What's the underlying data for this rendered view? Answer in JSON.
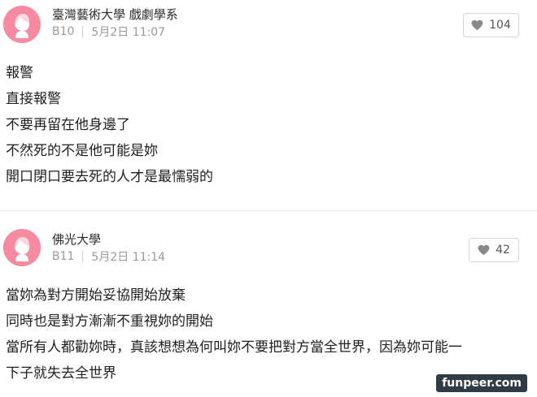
{
  "comments": [
    {
      "author": "臺灣藝術大學 戲劇學系",
      "floor": "B10",
      "time": "5月2日 11:07",
      "likes": "104",
      "lines": [
        "報警",
        "直接報警",
        "不要再留在他身邊了",
        "不然死的不是他可能是妳",
        "開口閉口要去死的人才是最懦弱的"
      ]
    },
    {
      "author": "佛光大學",
      "floor": "B11",
      "time": "5月2日 11:14",
      "likes": "42",
      "lines": [
        "當妳為對方開始妥協開始放棄",
        "同時也是對方漸漸不重視妳的開始",
        "當所有人都勸妳時，真該想想為何叫妳不要把對方當全世界，因為妳可能一",
        "下子就失去全世界"
      ]
    }
  ],
  "icons": {
    "avatar": "female-avatar-icon",
    "like": "heart-icon"
  },
  "colors": {
    "avatar": "#f58aa1",
    "watermark_bg": "#2f3c46"
  },
  "watermark": "funpeer.com"
}
